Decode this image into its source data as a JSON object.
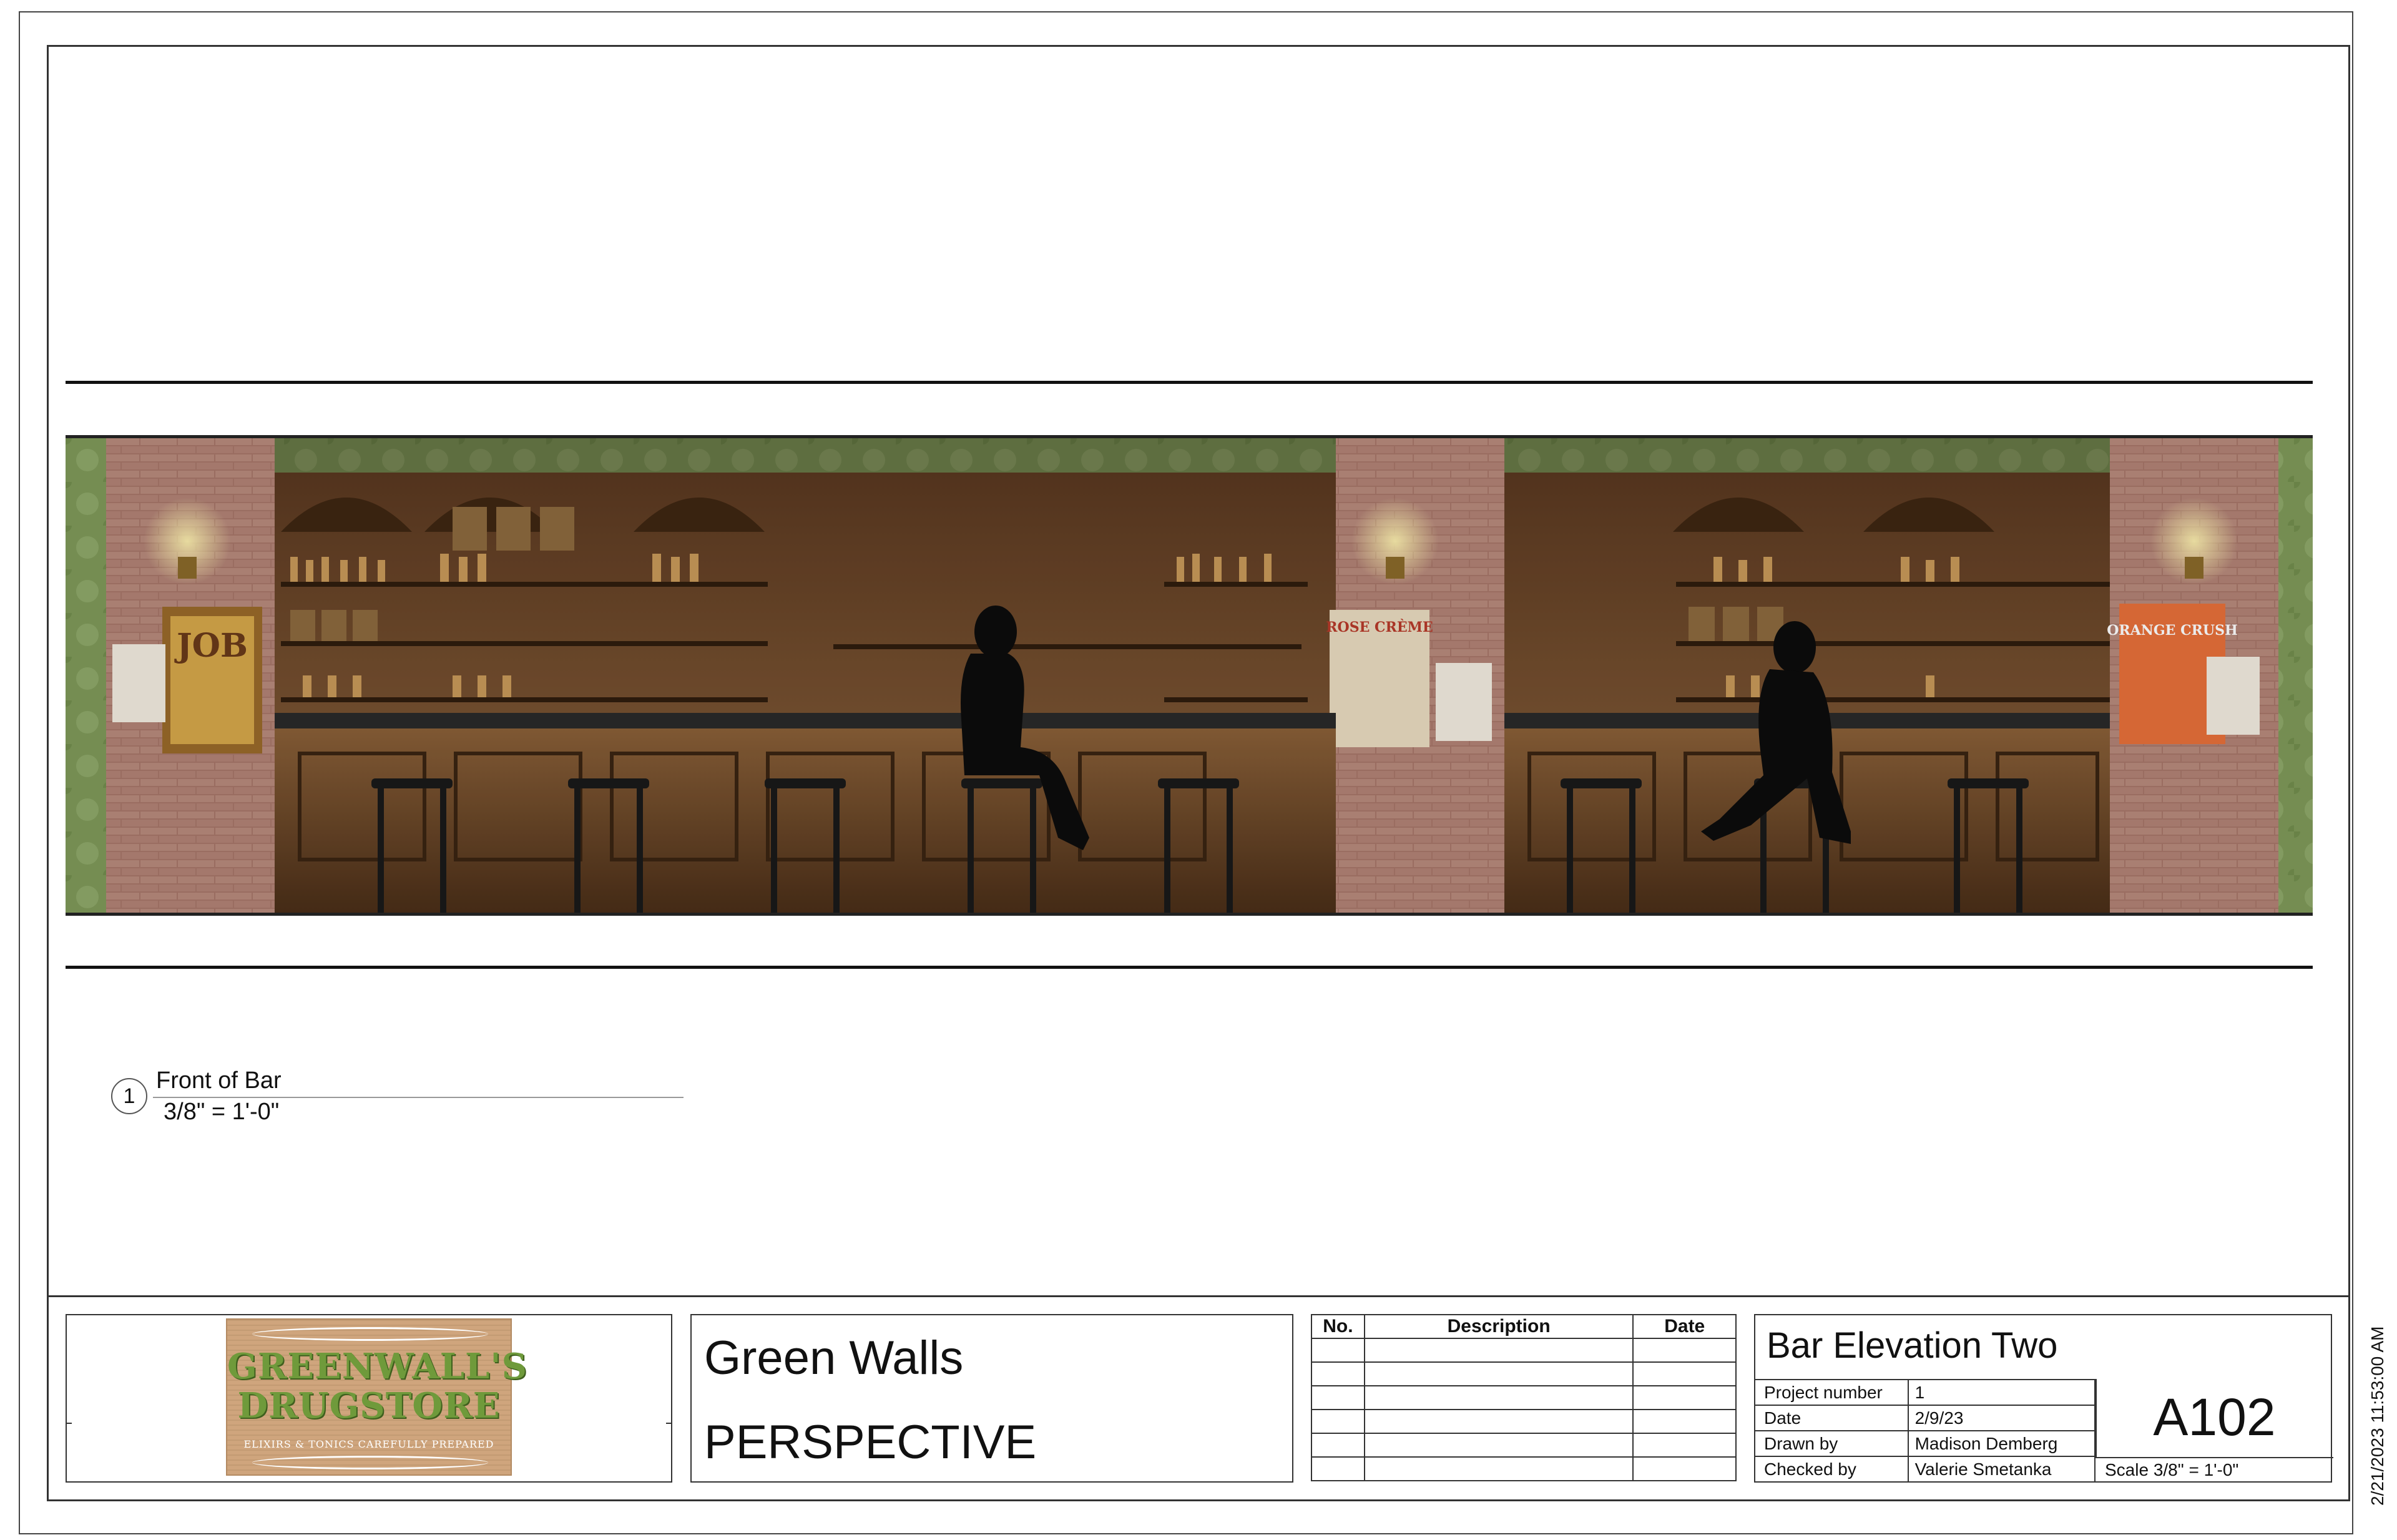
{
  "drawing": {
    "number": "1",
    "title": "Front of Bar",
    "scale": "3/8\" = 1'-0\""
  },
  "elevation": {
    "posters": {
      "left": "JOB",
      "middle": "ROSE CRÈME",
      "right": "ORANGE CRUSH"
    }
  },
  "logo": {
    "line1": "GREENWALL'S",
    "line2": "DRUGSTORE",
    "tagline": "ELIXIRS & TONICS CAREFULLY PREPARED"
  },
  "title_block": {
    "project_name": "Green Walls",
    "sheet_kind": "PERSPECTIVE"
  },
  "revisions": {
    "headers": {
      "no": "No.",
      "description": "Description",
      "date": "Date"
    },
    "rows": [
      [
        "",
        "",
        ""
      ],
      [
        "",
        "",
        ""
      ],
      [
        "",
        "",
        ""
      ],
      [
        "",
        "",
        ""
      ],
      [
        "",
        "",
        ""
      ],
      [
        "",
        "",
        ""
      ]
    ]
  },
  "sheet_info": {
    "sheet_name": "Bar Elevation Two",
    "rows": [
      {
        "label": "Project number",
        "value": "1"
      },
      {
        "label": "Date",
        "value": "2/9/23"
      },
      {
        "label": "Drawn by",
        "value": "Madison Demberg"
      },
      {
        "label": "Checked by",
        "value": "Valerie Smetanka"
      }
    ],
    "sheet_number": "A102",
    "scale": "Scale  3/8\" = 1'-0\""
  },
  "timestamp": "2/21/2023 11:53:00 AM",
  "colors": {
    "wall_green": "#7f9a5a",
    "brick": "#a8776a",
    "wood": "#6b4526",
    "logo_green": "#6f9a3b"
  }
}
